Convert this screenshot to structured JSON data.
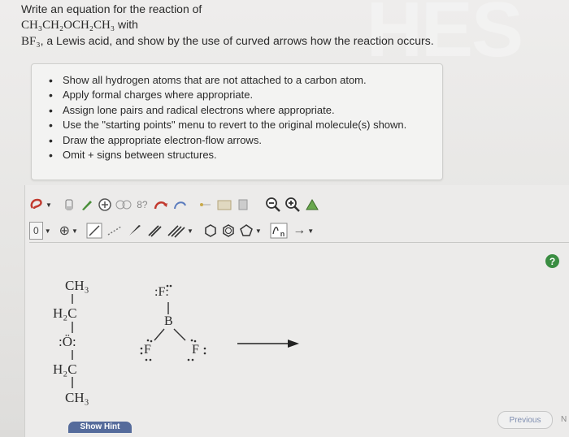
{
  "question": {
    "line1": "Write an equation for the reaction of",
    "line2_chem": "CH₃CH₂OCH₂CH₃",
    "line2_rest": " with",
    "line3_chem": "BF₃",
    "line3_rest": ", a Lewis acid, and show by the use of curved arrows how the reaction occurs."
  },
  "watermark": "HES",
  "instructions": [
    "Show all hydrogen atoms that are not attached to a carbon atom.",
    "Apply formal charges where appropriate.",
    "Assign lone pairs and radical electrons where appropriate.",
    "Use the \"starting points\" menu to revert to the original molecule(s) shown.",
    "Draw the appropriate electron-flow arrows.",
    "Omit + signs between structures."
  ],
  "toolbar": {
    "charge_value": "0",
    "add_symbol": "⊕",
    "chain_label": "n",
    "arrow_symbol": "→"
  },
  "molecule_ether": {
    "top": "CH₃",
    "c1": "H₂C",
    "oxygen": ":Ö:",
    "c2": "H₂C",
    "bottom": "CH₃"
  },
  "molecule_bf3": {
    "f_top": ":F:",
    "boron": "B",
    "f_left": "F",
    "f_right": "F"
  },
  "buttons": {
    "help": "?",
    "show_hint": "Show Hint",
    "previous": "Previous",
    "next_partial": "N"
  },
  "colors": {
    "help_green": "#3a8d42",
    "hint_blue": "#556b9b",
    "pen_green": "#4a8f3a",
    "highlight_red": "#c23a2f"
  }
}
